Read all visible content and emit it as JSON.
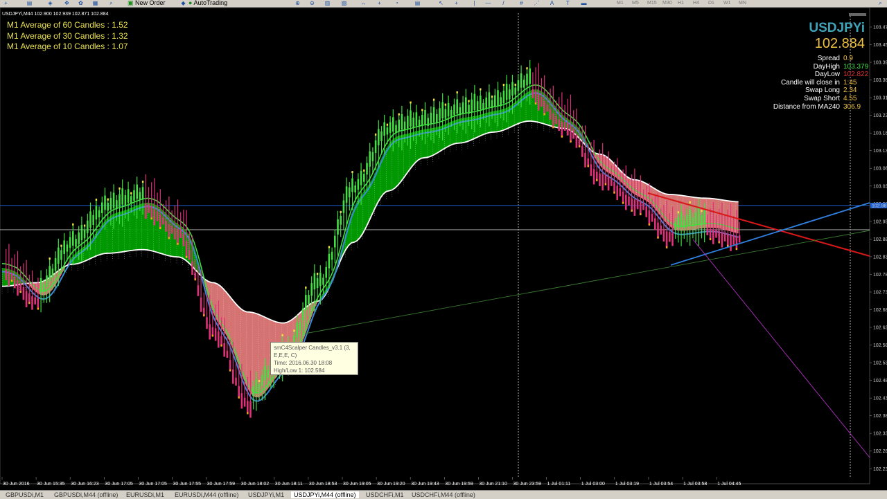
{
  "toolbar": {
    "new_order": "New Order",
    "auto_trading": "AutoTrading",
    "timeframes": [
      "M1",
      "M5",
      "M15",
      "M30",
      "H1",
      "H4",
      "D1",
      "W1",
      "MN"
    ]
  },
  "chart_header": "USDJPYi,M44  102.900 102.939 102.871 102.884",
  "averages": [
    "M1 Average of 60 Candles : 1.52",
    "M1 Average of 30 Candles : 1.32",
    "M1 Average of 10 Candles : 1.07"
  ],
  "symbol": {
    "name": "USDJPYi",
    "price": "102.884"
  },
  "info": [
    {
      "label": "Spread",
      "value": "0.9",
      "color": "#f0c040"
    },
    {
      "label": "DayHigh",
      "value": "103.379",
      "color": "#40e040"
    },
    {
      "label": "DayLow",
      "value": "102.822",
      "color": "#e03030"
    },
    {
      "label": "Candle will close in",
      "value": "1:45",
      "color": "#f0c040"
    },
    {
      "label": "Swap Long",
      "value": "2.34",
      "color": "#f0c040"
    },
    {
      "label": "Swap Short",
      "value": "4.55",
      "color": "#f0c040"
    },
    {
      "label": "Distance from MA240",
      "value": "306.9",
      "color": "#f0c040"
    }
  ],
  "tooltip": {
    "line1": "smC4Scalper Candles_v3.1 (3,",
    "line2": "E,E,E, C)",
    "line3": "Time: 2016.06.30 18:08",
    "line4": "High/Low 1: 102.584"
  },
  "price_axis": {
    "labels": [
      "103.47",
      "103.45",
      "103.39",
      "103.36",
      "103.31",
      "103.23",
      "103.18",
      "103.13",
      "103.08",
      "103.03",
      "102.98",
      "102.95",
      "102.88",
      "102.83",
      "102.78",
      "102.73",
      "102.68",
      "102.63",
      "102.58",
      "102.53",
      "102.48",
      "102.43",
      "102.38",
      "102.33",
      "102.28",
      "102.23"
    ],
    "current": "102.98"
  },
  "time_axis": [
    "30 Jun 2016",
    "30 Jun 15:35",
    "30 Jun 16:23",
    "30 Jun 17:05",
    "30 Jun 17:05",
    "30 Jun 17:55",
    "30 Jun 17:59",
    "30 Jun 18:02",
    "30 Jun 18:11",
    "30 Jun 18:53",
    "30 Jun 19:05",
    "30 Jun 19:20",
    "30 Jun 19:43",
    "30 Jun 19:59",
    "30 Jun 21:10",
    "30 Jun 23:59",
    "1 Jul 01:11",
    "1 Jul 03:00",
    "1 Jul 03:19",
    "1 Jul 03:54",
    "1 Jul 03:58",
    "1 Jul 04:45"
  ],
  "tabs": [
    {
      "label": "GBPUSDi,M1",
      "active": false
    },
    {
      "label": "GBPUSDi,M44 (offline)",
      "active": false
    },
    {
      "label": "EURUSDi,M1",
      "active": false
    },
    {
      "label": "EURUSDi,M44 (offline)",
      "active": false
    },
    {
      "label": "USDJPYi,M1",
      "active": false
    },
    {
      "label": "USDJPYi,M44 (offline)",
      "active": true
    },
    {
      "label": "USDCHFi,M1",
      "active": false
    },
    {
      "label": "USDCHFi,M44 (offline)",
      "active": false
    }
  ],
  "colors": {
    "bull_fill": "#00a000",
    "bear_fill": "#e07878",
    "fast_ma": "#3a8ad8",
    "slow_ma": "#ffffff",
    "ma_green": "#40e040",
    "candle_up": "#40e040",
    "candle_down": "#e0307a",
    "tail_orange": "#ffa020",
    "trend_red": "#d81818",
    "trend_blue": "#3080e0",
    "trend_green": "#3a7a30",
    "trend_magenta": "#b030c0"
  },
  "chart_data": {
    "type": "candlestick",
    "symbol": "USDJPYi",
    "timeframe": "M44",
    "last_price": 102.884,
    "ylim": [
      102.23,
      103.47
    ],
    "x": [
      "30 Jun 2016",
      "30 Jun 15:35",
      "30 Jun 16:23",
      "30 Jun 17:05",
      "30 Jun 17:05",
      "30 Jun 17:55",
      "30 Jun 17:59",
      "30 Jun 18:02",
      "30 Jun 18:11",
      "30 Jun 18:53",
      "30 Jun 19:05",
      "30 Jun 19:20",
      "30 Jun 19:43",
      "30 Jun 19:59",
      "30 Jun 21:10",
      "30 Jun 23:59",
      "1 Jul 01:11",
      "1 Jul 03:00",
      "1 Jul 03:19",
      "1 Jul 03:54",
      "1 Jul 03:58",
      "1 Jul 04:45"
    ],
    "close_path": [
      102.78,
      102.7,
      102.83,
      102.93,
      102.96,
      102.89,
      102.62,
      102.42,
      102.52,
      102.72,
      102.98,
      103.14,
      103.16,
      103.19,
      103.21,
      103.27,
      103.18,
      103.04,
      102.97,
      102.88,
      102.89,
      102.87
    ],
    "slow_ma": [
      102.73,
      102.74,
      102.79,
      102.82,
      102.83,
      102.81,
      102.74,
      102.66,
      102.63,
      102.69,
      102.85,
      102.99,
      103.08,
      103.12,
      103.15,
      103.18,
      103.16,
      103.09,
      103.02,
      102.98,
      102.97,
      102.96
    ],
    "horizontal_lines": [
      102.95,
      102.884
    ]
  }
}
